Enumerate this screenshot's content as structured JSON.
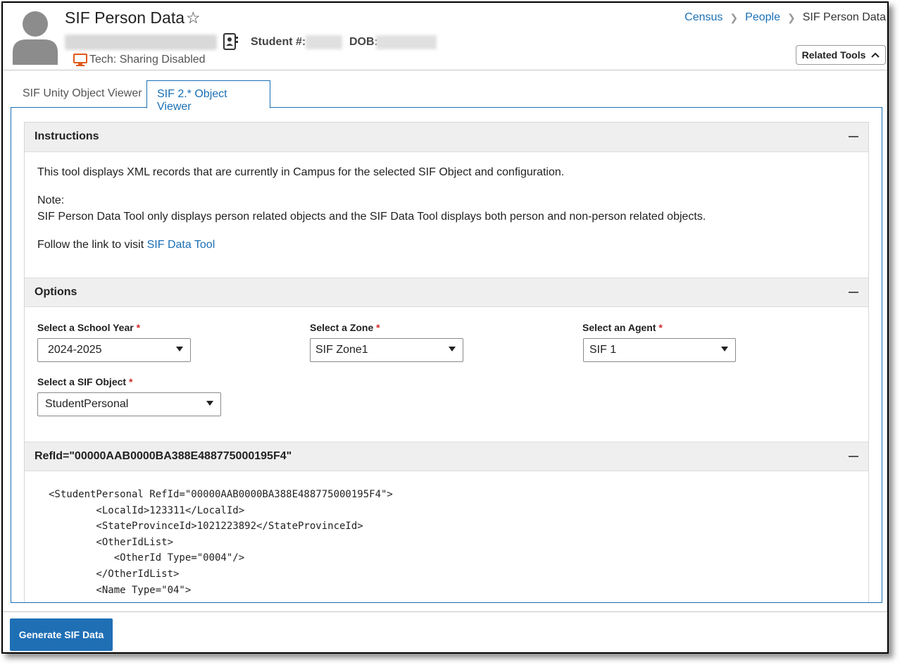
{
  "header": {
    "title": "SIF Person Data",
    "student_label": "Student #:",
    "dob_label": "DOB:",
    "tech_status": "Tech: Sharing Disabled",
    "related_tools_label": "Related Tools"
  },
  "breadcrumb": {
    "items": [
      "Census",
      "People"
    ],
    "current": "SIF Person Data"
  },
  "tabs": [
    {
      "label": "SIF Unity Object Viewer",
      "active": false
    },
    {
      "label": "SIF 2.* Object Viewer",
      "active": true
    }
  ],
  "instructions": {
    "title": "Instructions",
    "line1": "This tool displays XML records that are currently in Campus for the selected SIF Object and configuration.",
    "note_label": "Note:",
    "note_text": "SIF Person Data Tool only displays person related objects and the SIF Data Tool displays both person and non-person related objects.",
    "follow_text": "Follow the link to visit ",
    "link_text": "SIF Data Tool"
  },
  "options": {
    "title": "Options",
    "school_year": {
      "label": "Select a School Year",
      "value": "2024-2025"
    },
    "zone": {
      "label": "Select a Zone",
      "value": "SIF Zone1"
    },
    "agent": {
      "label": "Select an Agent",
      "value": "SIF 1"
    },
    "sif_object": {
      "label": "Select a SIF Object",
      "value": "StudentPersonal"
    },
    "required_mark": "*"
  },
  "record": {
    "title": "RefId=\"00000AAB0000BA388E488775000195F4\"",
    "xml_lines": [
      "<StudentPersonal RefId=\"00000AAB0000BA388E488775000195F4\">",
      "        <LocalId>123311</LocalId>",
      "        <StateProvinceId>1021223892</StateProvinceId>",
      "        <OtherIdList>",
      "           <OtherId Type=\"0004\"/>",
      "        </OtherIdList>",
      "        <Name Type=\"04\">"
    ]
  },
  "footer": {
    "generate_label": "Generate SIF Data"
  },
  "colors": {
    "accent": "#1a6fb5",
    "button": "#1f6fb5",
    "required": "#d02b2b",
    "tech_icon": "#e0591b"
  }
}
